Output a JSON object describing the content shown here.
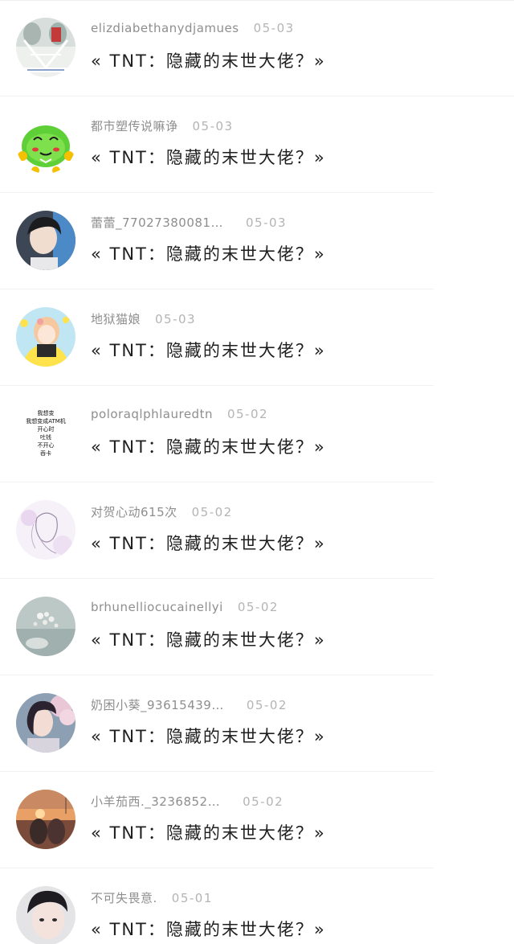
{
  "comments": [
    {
      "username": "elizdiabethanydjamues",
      "date": "05-03",
      "title": "« TNT：隐藏的末世大佬？»",
      "avatar": "avatar-heart-photo"
    },
    {
      "username": "都市塑传说嘛诤",
      "date": "05-03",
      "title": "« TNT：隐藏的末世大佬？»",
      "avatar": "avatar-green-cartoon"
    },
    {
      "username": "蕾蕾_77027380081…",
      "date": "05-03",
      "title": "« TNT：隐藏的末世大佬？»",
      "avatar": "avatar-boy-portrait"
    },
    {
      "username": "地狱猫娘",
      "date": "05-03",
      "title": "« TNT：隐藏的末世大佬？»",
      "avatar": "avatar-anime-girl"
    },
    {
      "username": "poloraqlphlauredtn",
      "date": "05-02",
      "title": "« TNT：隐藏的末世大佬？»",
      "avatar": "avatar-text",
      "avatar_text": [
        "我想变",
        "我想变成ATM机",
        "开心时",
        "吐钱",
        "不开心",
        "吞卡"
      ]
    },
    {
      "username": "对贺心动615次",
      "date": "05-02",
      "title": "« TNT：隐藏的末世大佬？»",
      "avatar": "avatar-sketch-girl"
    },
    {
      "username": "brhunelliocucainellyi",
      "date": "05-02",
      "title": "« TNT：隐藏的末世大佬？»",
      "avatar": "avatar-pearls"
    },
    {
      "username": "奶困小葵_93615439…",
      "date": "05-02",
      "title": "« TNT：隐藏的末世大佬？»",
      "avatar": "avatar-girl-blossom"
    },
    {
      "username": "小羊茄西._3236852…",
      "date": "05-02",
      "title": "« TNT：隐藏的末世大佬？»",
      "avatar": "avatar-sunset-friends"
    },
    {
      "username": "不可失畏意.",
      "date": "05-01",
      "title": "« TNT：隐藏的末世大佬？»",
      "avatar": "avatar-boy-closeup"
    }
  ],
  "colors": {
    "username": "#8e8e8e",
    "date": "#b4b4b4",
    "title": "#1f1f1f",
    "divider": "#f1f1f1",
    "background": "#ffffff"
  }
}
